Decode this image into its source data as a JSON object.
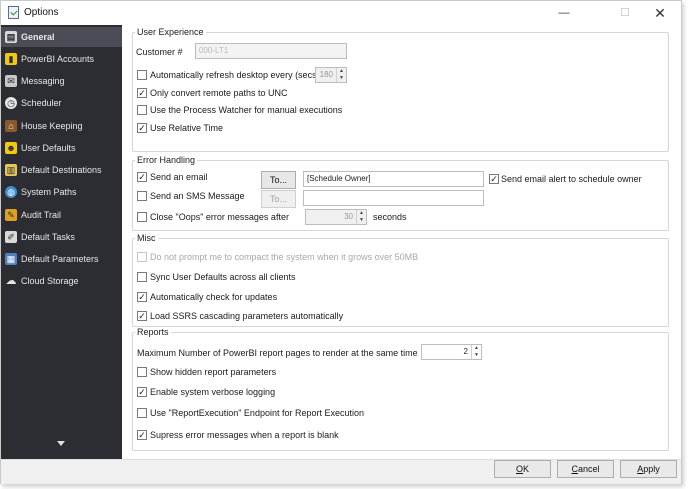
{
  "window": {
    "title": "Options",
    "minimize": "—",
    "maximize": "☐",
    "close": "✕"
  },
  "sidebar": {
    "items": [
      {
        "label": "General",
        "icon": "general-icon",
        "active": true
      },
      {
        "label": "PowerBI Accounts",
        "icon": "powerbi-icon"
      },
      {
        "label": "Messaging",
        "icon": "messaging-icon"
      },
      {
        "label": "Scheduler",
        "icon": "clock-icon"
      },
      {
        "label": "House Keeping",
        "icon": "housekeeping-icon"
      },
      {
        "label": "User Defaults",
        "icon": "user-icon"
      },
      {
        "label": "Default Destinations",
        "icon": "destinations-icon"
      },
      {
        "label": "System Paths",
        "icon": "globe-icon"
      },
      {
        "label": "Audit Trail",
        "icon": "pen-icon"
      },
      {
        "label": "Default Tasks",
        "icon": "tasks-icon"
      },
      {
        "label": "Default Parameters",
        "icon": "parameters-icon"
      },
      {
        "label": "Cloud Storage",
        "icon": "cloud-icon"
      }
    ],
    "scroll_down_icon": "chevron-down-icon"
  },
  "user_experience": {
    "legend": "User Experience",
    "customer_label": "Customer #",
    "customer_value": "000-LT1",
    "auto_refresh_label": "Automatically refresh desktop every (secs)",
    "auto_refresh_checked": false,
    "auto_refresh_value": "180",
    "unc_label": "Only convert remote paths to UNC",
    "unc_checked": true,
    "watcher_label": "Use the Process Watcher for manual executions",
    "watcher_checked": false,
    "relative_time_label": "Use Relative Time",
    "relative_time_checked": true
  },
  "error_handling": {
    "legend": "Error Handling",
    "send_email_label": "Send an email",
    "send_email_checked": true,
    "to_button": "To...",
    "email_to_value": "[Schedule Owner]",
    "alert_owner_label": "Send email alert to schedule owner",
    "alert_owner_checked": true,
    "send_sms_label": "Send an SMS Message",
    "send_sms_checked": false,
    "sms_to_button": "To...",
    "sms_to_value": "",
    "close_oops_label": "Close \"Oops\" error messages after",
    "close_oops_checked": false,
    "close_oops_value": "30",
    "seconds_label": "seconds"
  },
  "misc": {
    "legend": "Misc",
    "compact_label": "Do not prompt me to compact the system when it grows over 50MB",
    "sync_label": "Sync User Defaults across all clients",
    "sync_checked": false,
    "updates_label": "Automatically check for updates",
    "updates_checked": true,
    "ssrs_label": "Load SSRS cascading parameters automatically",
    "ssrs_checked": true
  },
  "reports": {
    "legend": "Reports",
    "max_pages_label": "Maximum Number  of PowerBI report pages to render at the same time",
    "max_pages_value": "2",
    "hidden_params_label": "Show hidden report parameters",
    "hidden_params_checked": false,
    "verbose_label": "Enable system verbose logging",
    "verbose_checked": true,
    "endpoint_label": "Use \"ReportExecution\" Endpoint for Report Execution",
    "endpoint_checked": false,
    "suppress_label": "Supress error messages when a report is blank",
    "suppress_checked": true
  },
  "footer": {
    "ok": "OK",
    "cancel": "Cancel",
    "apply": "Apply"
  },
  "colors": {
    "sidebar_bg": "#2b2d33",
    "sidebar_active": "#4a4d55",
    "sidebar_text": "#e8e8e8"
  }
}
